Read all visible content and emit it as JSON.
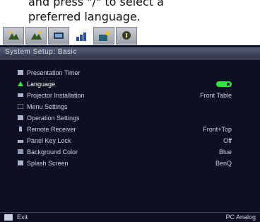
{
  "caption": {
    "line1": "and press \"/\" to select a",
    "line2": "preferred language."
  },
  "tabs": [
    {
      "name": "picture-tab",
      "active": false
    },
    {
      "name": "picture-advanced-tab",
      "active": false
    },
    {
      "name": "display-tab",
      "active": false
    },
    {
      "name": "system-setup-basic-tab",
      "active": true
    },
    {
      "name": "system-setup-advanced-tab",
      "active": false
    },
    {
      "name": "information-tab",
      "active": false
    }
  ],
  "menu": {
    "title": "System Setup: Basic",
    "items": [
      {
        "label": "Presentation Timer",
        "value": "",
        "selected": false
      },
      {
        "label": "Language",
        "value": "",
        "selected": true
      },
      {
        "label": "Projector Installation",
        "value": "Front Table",
        "selected": false
      },
      {
        "label": "Menu Settings",
        "value": "",
        "selected": false
      },
      {
        "label": "Operation Settings",
        "value": "",
        "selected": false
      },
      {
        "label": "Remote Receiver",
        "value": "Front+Top",
        "selected": false
      },
      {
        "label": "Panel Key Lock",
        "value": "Off",
        "selected": false
      },
      {
        "label": "Background Color",
        "value": "Blue",
        "selected": false
      },
      {
        "label": "Splash Screen",
        "value": "BenQ",
        "selected": false
      }
    ],
    "footer_left": "Exit",
    "footer_right": "PC Analog"
  },
  "colors": {
    "panel_bg": "#0d1022",
    "toggle_on": "#2ee63a"
  }
}
